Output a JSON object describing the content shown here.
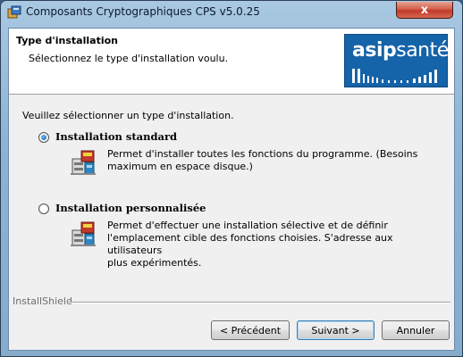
{
  "window": {
    "title": "Composants Cryptographiques CPS v5.0.25",
    "close_label": "x"
  },
  "header": {
    "title": "Type d'installation",
    "subtitle": "Sélectionnez le type d'installation voulu."
  },
  "logo": {
    "word_bold": "asip",
    "word_light": "santé",
    "color": "#1563a8"
  },
  "intro": "Veuillez sélectionner un type d'installation.",
  "options": [
    {
      "label": "Installation standard",
      "selected": true,
      "desc_line1": "Permet d'installer toutes les fonctions du programme. (Besoins",
      "desc_line2": "maximum en espace disque.)",
      "icon": "installer-package-icon"
    },
    {
      "label": "Installation personnalisée",
      "selected": false,
      "desc_line1": "Permet d'effectuer une installation sélective et de définir",
      "desc_line2": "l'emplacement cible des fonctions choisies. S'adresse aux utilisateurs",
      "desc_line3": "plus expérimentés.",
      "icon": "installer-package-icon"
    }
  ],
  "footer": {
    "brand": "InstallShield",
    "back_label": "< Précédent",
    "next_label": "Suivant >",
    "cancel_label": "Annuler"
  }
}
